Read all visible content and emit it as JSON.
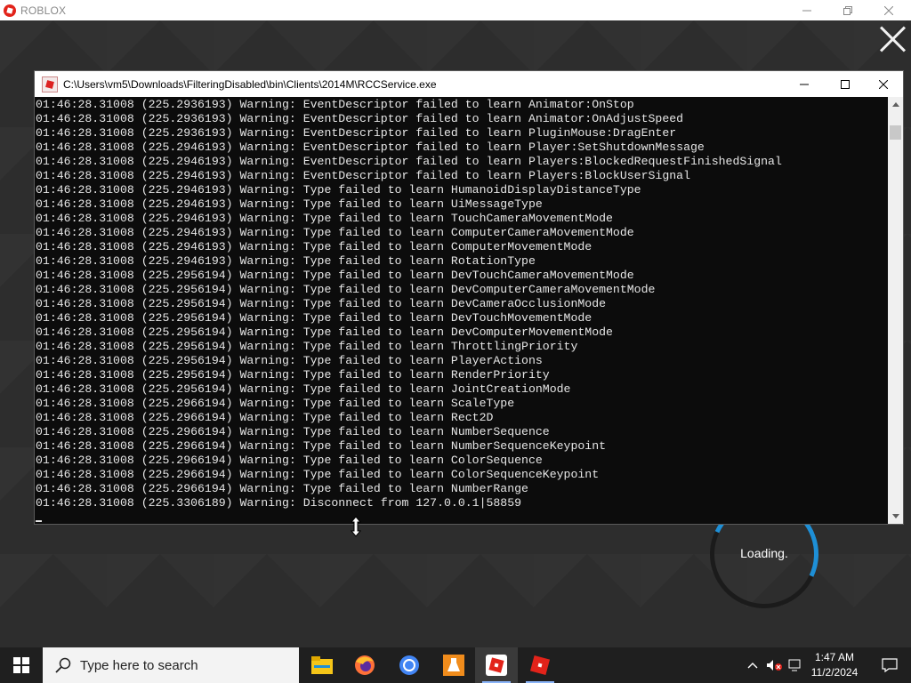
{
  "roblox": {
    "title": "ROBLOX",
    "loading_text": "Loading."
  },
  "console": {
    "title": "C:\\Users\\vm5\\Downloads\\FilteringDisabled\\bin\\Clients\\2014M\\RCCService.exe",
    "lines": [
      "01:46:28.31008 (225.2936193) Warning: EventDescriptor failed to learn Animator:OnStop",
      "01:46:28.31008 (225.2936193) Warning: EventDescriptor failed to learn Animator:OnAdjustSpeed",
      "01:46:28.31008 (225.2936193) Warning: EventDescriptor failed to learn PluginMouse:DragEnter",
      "01:46:28.31008 (225.2946193) Warning: EventDescriptor failed to learn Player:SetShutdownMessage",
      "01:46:28.31008 (225.2946193) Warning: EventDescriptor failed to learn Players:BlockedRequestFinishedSignal",
      "01:46:28.31008 (225.2946193) Warning: EventDescriptor failed to learn Players:BlockUserSignal",
      "01:46:28.31008 (225.2946193) Warning: Type failed to learn HumanoidDisplayDistanceType",
      "01:46:28.31008 (225.2946193) Warning: Type failed to learn UiMessageType",
      "01:46:28.31008 (225.2946193) Warning: Type failed to learn TouchCameraMovementMode",
      "01:46:28.31008 (225.2946193) Warning: Type failed to learn ComputerCameraMovementMode",
      "01:46:28.31008 (225.2946193) Warning: Type failed to learn ComputerMovementMode",
      "01:46:28.31008 (225.2946193) Warning: Type failed to learn RotationType",
      "01:46:28.31008 (225.2956194) Warning: Type failed to learn DevTouchCameraMovementMode",
      "01:46:28.31008 (225.2956194) Warning: Type failed to learn DevComputerCameraMovementMode",
      "01:46:28.31008 (225.2956194) Warning: Type failed to learn DevCameraOcclusionMode",
      "01:46:28.31008 (225.2956194) Warning: Type failed to learn DevTouchMovementMode",
      "01:46:28.31008 (225.2956194) Warning: Type failed to learn DevComputerMovementMode",
      "01:46:28.31008 (225.2956194) Warning: Type failed to learn ThrottlingPriority",
      "01:46:28.31008 (225.2956194) Warning: Type failed to learn PlayerActions",
      "01:46:28.31008 (225.2956194) Warning: Type failed to learn RenderPriority",
      "01:46:28.31008 (225.2956194) Warning: Type failed to learn JointCreationMode",
      "01:46:28.31008 (225.2966194) Warning: Type failed to learn ScaleType",
      "01:46:28.31008 (225.2966194) Warning: Type failed to learn Rect2D",
      "01:46:28.31008 (225.2966194) Warning: Type failed to learn NumberSequence",
      "01:46:28.31008 (225.2966194) Warning: Type failed to learn NumberSequenceKeypoint",
      "01:46:28.31008 (225.2966194) Warning: Type failed to learn ColorSequence",
      "01:46:28.31008 (225.2966194) Warning: Type failed to learn ColorSequenceKeypoint",
      "01:46:28.31008 (225.2966194) Warning: Type failed to learn NumberRange",
      "01:46:28.31008 (225.3306189) Warning: Disconnect from 127.0.0.1|58859"
    ]
  },
  "taskbar": {
    "search_placeholder": "Type here to search",
    "apps": [
      {
        "name": "file-explorer-icon",
        "color": "#f5c518"
      },
      {
        "name": "firefox-icon",
        "color": "#ff7139"
      },
      {
        "name": "chrome-icon",
        "color": "#4285f4"
      },
      {
        "name": "lab-flask-icon",
        "color": "#f08c1c"
      },
      {
        "name": "roblox-player-icon",
        "color": "#e2231a"
      },
      {
        "name": "roblox-studio-icon",
        "color": "#e2231a"
      }
    ],
    "clock_time": "1:47 AM",
    "clock_date": "11/2/2024"
  },
  "colors": {
    "console_bg": "#0c0c0c",
    "console_text": "#e6e6e6",
    "loading_accent": "#1e8fd6",
    "taskbar_bg": "#1f1f1f"
  }
}
